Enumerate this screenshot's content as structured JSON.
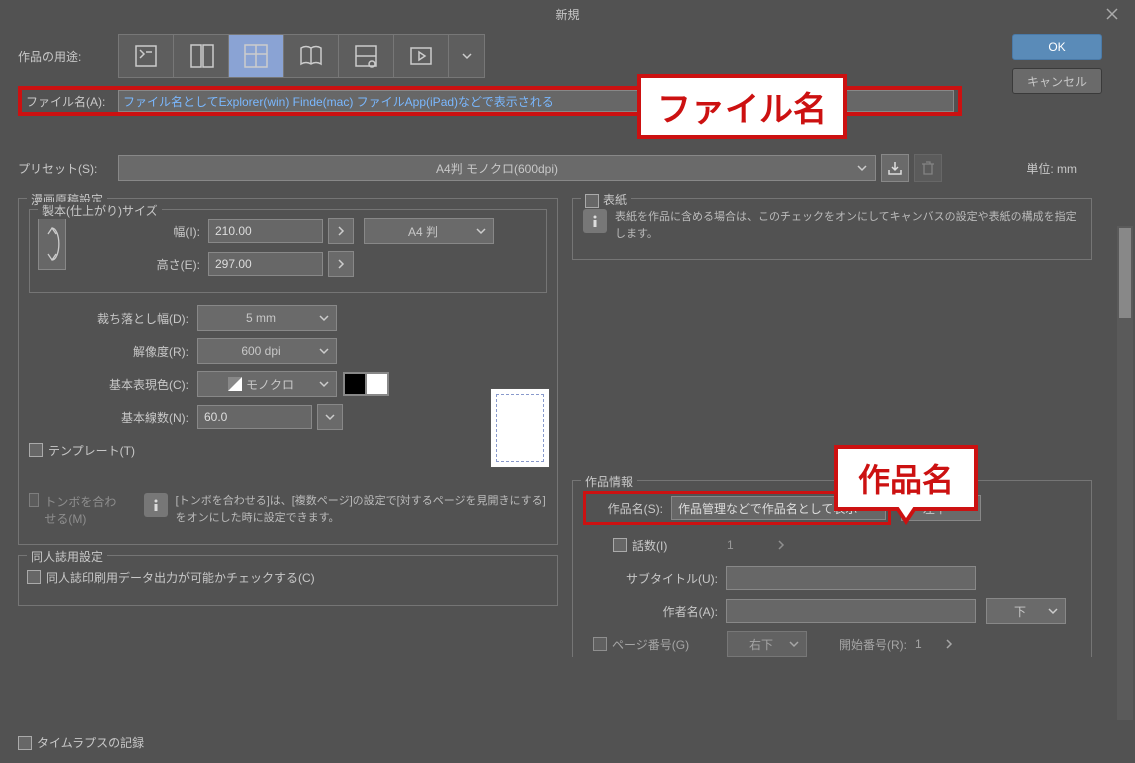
{
  "window": {
    "title": "新規"
  },
  "buttons": {
    "ok": "OK",
    "cancel": "キャンセル"
  },
  "purpose": {
    "label": "作品の用途:"
  },
  "filename": {
    "label": "ファイル名(A):",
    "value": "ファイル名としてExplorer(win) Finde(mac) ファイルApp(iPad)などで表示される",
    "callout": "ファイル名"
  },
  "preset": {
    "label": "プリセット(S):",
    "selected": "A4判 モノクロ(600dpi)",
    "unit": "単位: mm"
  },
  "manga": {
    "legend": "漫画原稿設定",
    "binding_legend": "製本(仕上がり)サイズ",
    "width_label": "幅(I):",
    "width_value": "210.00",
    "height_label": "高さ(E):",
    "height_value": "297.00",
    "paper_select": "A4 判",
    "bleed_label": "裁ち落とし幅(D):",
    "bleed_value": "5 mm",
    "dpi_label": "解像度(R):",
    "dpi_value": "600 dpi",
    "color_label": "基本表現色(C):",
    "color_value": "モノクロ",
    "lines_label": "基本線数(N):",
    "lines_value": "60.0",
    "template_label": "テンプレート(T)",
    "crop_label": "トンボを合わせる(M)",
    "crop_info": "[トンボを合わせる]は、[複数ページ]の設定で[対するページを見開きにする]をオンにした時に設定できます。"
  },
  "doujin": {
    "legend": "同人誌用設定",
    "label": "同人誌印刷用データ出力が可能かチェックする(C)"
  },
  "cover": {
    "legend": "表紙",
    "info": "表紙を作品に含める場合は、このチェックをオンにしてキャンバスの設定や表紙の構成を指定します。"
  },
  "work": {
    "legend": "作品情報",
    "name_label": "作品名(S):",
    "name_value": "作品管理などで作品名として表示",
    "name_pos": "左下",
    "episode_label": "話数(I)",
    "episode_value": "1",
    "subtitle_label": "サブタイトル(U):",
    "author_label": "作者名(A):",
    "author_pos": "下",
    "page_label": "ページ番号(G)",
    "page_pos": "右下",
    "startnum_label": "開始番号(R):",
    "startnum_value": "1",
    "callout": "作品名"
  },
  "timelapse": {
    "label": "タイムラプスの記録"
  }
}
